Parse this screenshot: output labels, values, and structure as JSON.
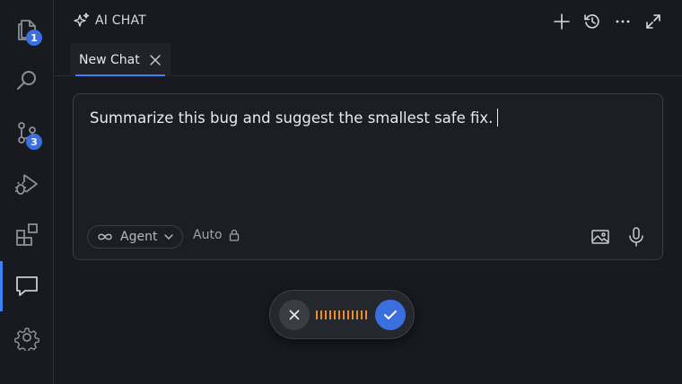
{
  "activity_bar": {
    "items": [
      {
        "name": "explorer",
        "icon": "files-icon",
        "badge": "1"
      },
      {
        "name": "search",
        "icon": "search-icon"
      },
      {
        "name": "source-control",
        "icon": "source-control-icon",
        "badge": "3"
      },
      {
        "name": "run-debug",
        "icon": "run-debug-icon"
      },
      {
        "name": "extensions",
        "icon": "extensions-icon"
      },
      {
        "name": "chat",
        "icon": "chat-icon",
        "active": true
      },
      {
        "name": "settings",
        "icon": "gear-icon"
      }
    ]
  },
  "header": {
    "title": "AI CHAT",
    "actions": [
      "plus-icon",
      "history-icon",
      "more-icon",
      "expand-icon"
    ]
  },
  "tabs": [
    {
      "label": "New Chat",
      "active": true
    }
  ],
  "chat_input": {
    "text": "Summarize this bug and suggest the smallest safe fix.",
    "mode_label": "Agent",
    "model_label": "Auto"
  },
  "voice": {
    "state": "recording"
  },
  "colors": {
    "background": "#181a1f",
    "accent": "#3b82f6",
    "confirm": "#3b6fe0",
    "waveform": "#f08c28"
  }
}
